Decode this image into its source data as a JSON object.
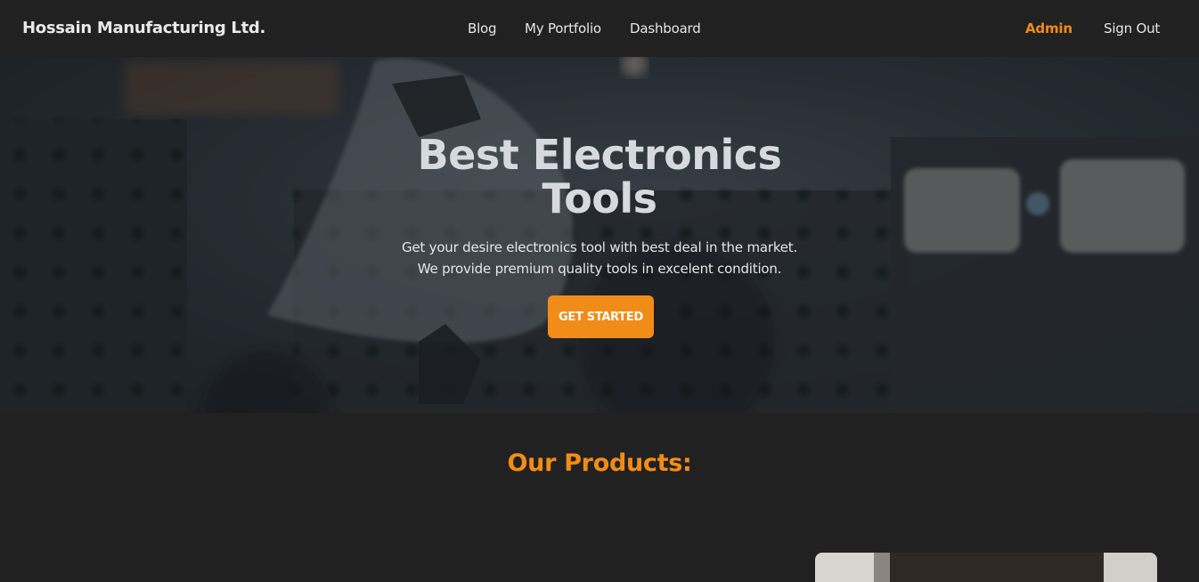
{
  "navbar": {
    "brand": "Hossain Manufacturing Ltd.",
    "links": [
      "Blog",
      "My Portfolio",
      "Dashboard"
    ],
    "admin_label": "Admin",
    "signout_label": "Sign Out",
    "accent_color": "#f28c18"
  },
  "hero": {
    "title_line1": "Best Electronics",
    "title_line2": "Tools",
    "subtitle_line1": "Get your desire electronics tool with best deal in the market.",
    "subtitle_line2": "We provide premium quality tools in excelent condition.",
    "cta_label": "GET STARTED"
  },
  "products": {
    "heading": "Our Products:"
  }
}
